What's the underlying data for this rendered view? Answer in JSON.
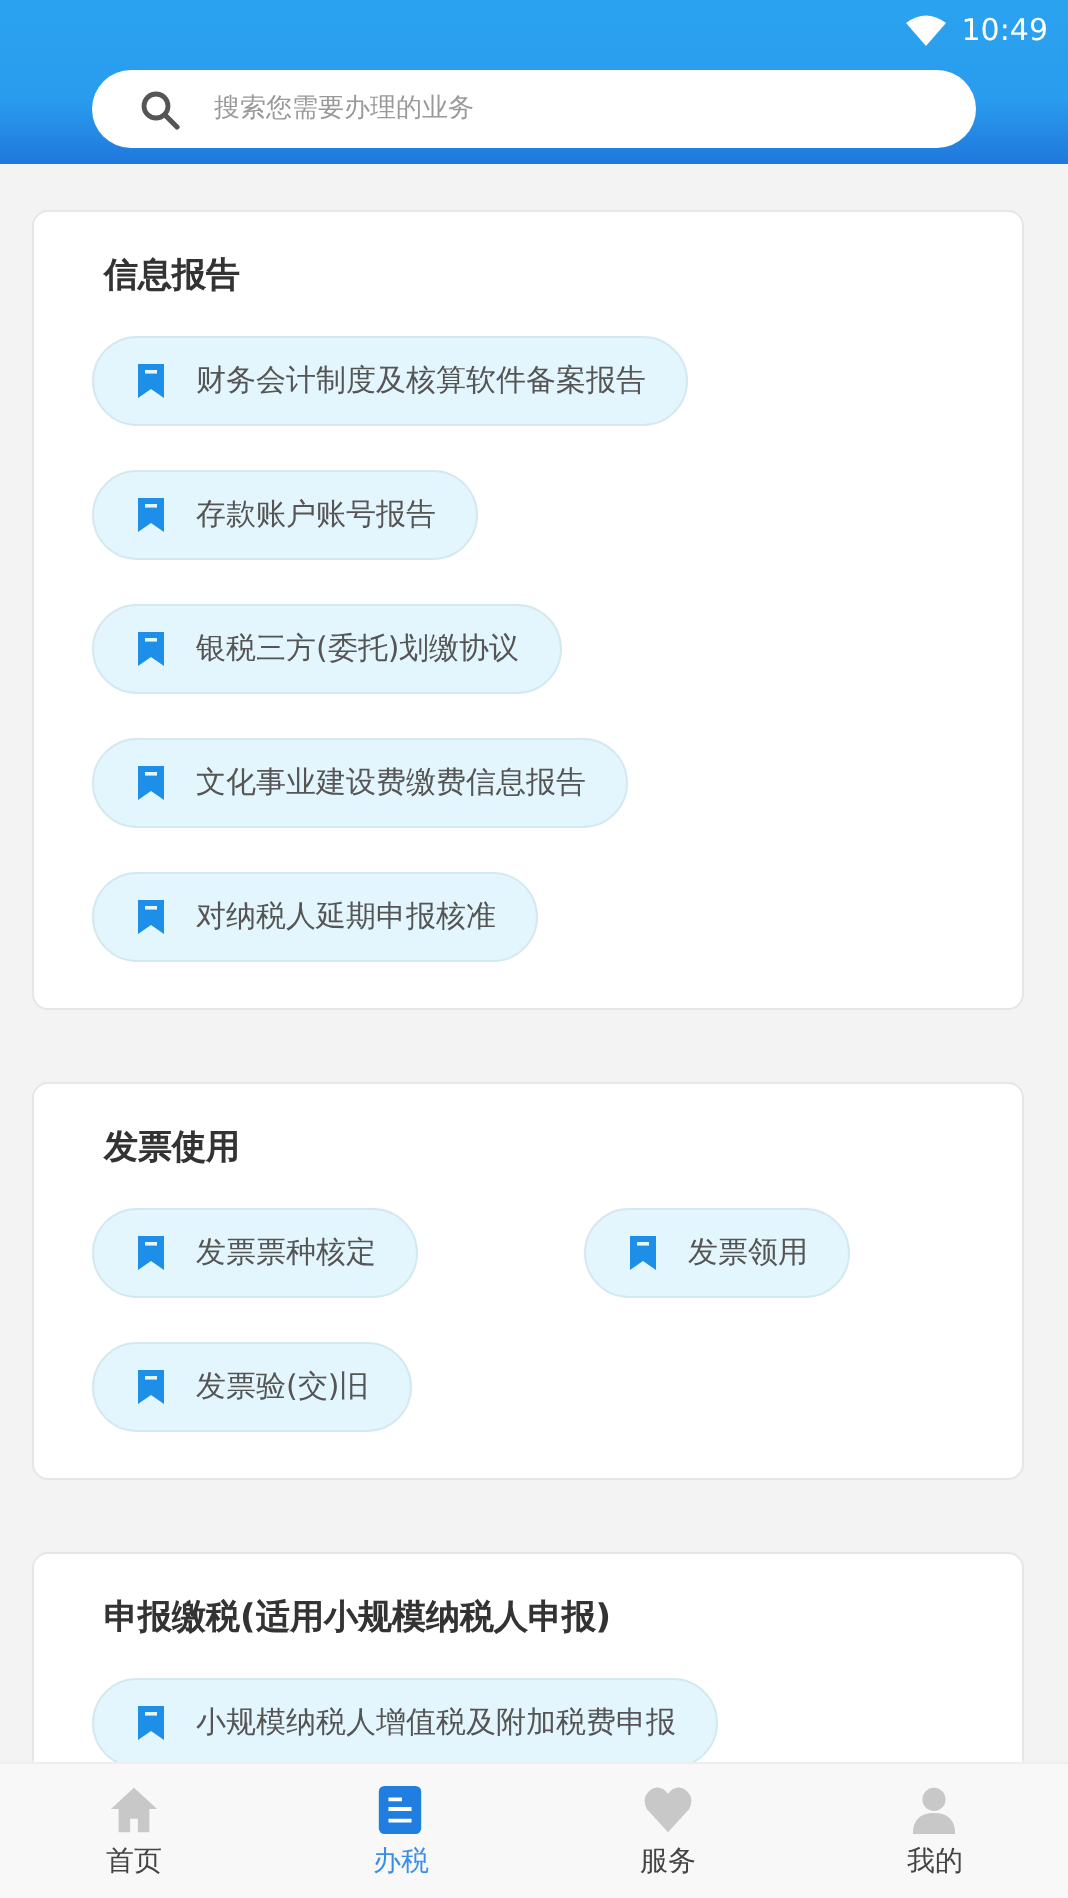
{
  "status_bar": {
    "time": "10:49"
  },
  "search": {
    "placeholder": "搜索您需要办理的业务"
  },
  "sections": [
    {
      "title": "信息报告",
      "kind": "list",
      "items": [
        "财务会计制度及核算软件备案报告",
        "存款账户账号报告",
        "银税三方(委托)划缴协议",
        "文化事业建设费缴费信息报告",
        "对纳税人延期申报核准"
      ]
    },
    {
      "title": "发票使用",
      "kind": "grid",
      "items": [
        "发票票种核定",
        "发票领用",
        "发票验(交)旧"
      ]
    },
    {
      "title": "申报缴税(适用小规模纳税人申报)",
      "kind": "list",
      "items": [
        "小规模纳税人增值税及附加税费申报"
      ]
    }
  ],
  "nav": [
    {
      "label": "首页",
      "kind": "home",
      "selected": false
    },
    {
      "label": "办税",
      "kind": "tax",
      "selected": true
    },
    {
      "label": "服务",
      "kind": "service",
      "selected": false
    },
    {
      "label": "我的",
      "kind": "profile",
      "selected": false
    }
  ]
}
